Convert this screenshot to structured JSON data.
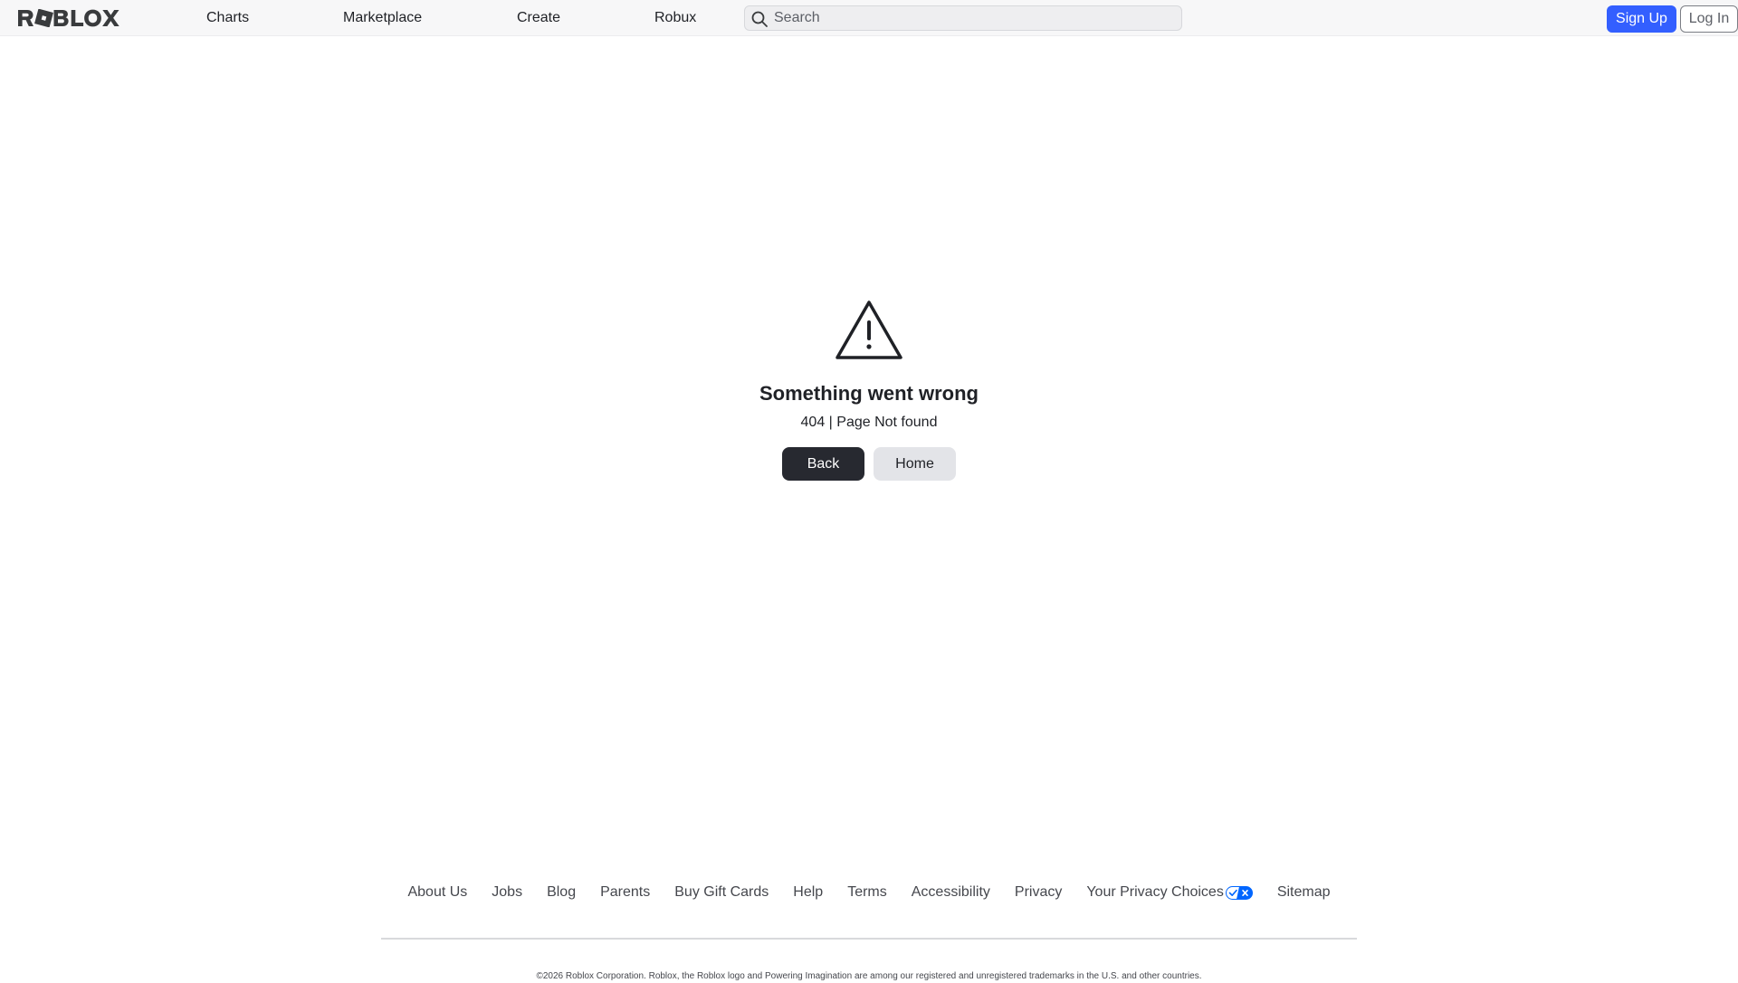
{
  "brand": {
    "logo_text": "ROBLOX",
    "accent": "#335fff"
  },
  "nav": {
    "items": [
      {
        "label": "Charts"
      },
      {
        "label": "Marketplace"
      },
      {
        "label": "Create"
      },
      {
        "label": "Robux"
      }
    ],
    "search": {
      "placeholder": "Search",
      "value": "",
      "icon": "search-icon"
    },
    "signup_label": "Sign Up",
    "login_label": "Log In"
  },
  "error": {
    "icon": "warning-triangle-icon",
    "title": "Something went wrong",
    "message": "404 | Page Not found",
    "back_label": "Back",
    "home_label": "Home"
  },
  "footer": {
    "links": [
      {
        "label": "About Us"
      },
      {
        "label": "Jobs"
      },
      {
        "label": "Blog"
      },
      {
        "label": "Parents"
      },
      {
        "label": "Buy Gift Cards"
      },
      {
        "label": "Help"
      },
      {
        "label": "Terms"
      },
      {
        "label": "Accessibility"
      },
      {
        "label": "Privacy"
      },
      {
        "label": "Your Privacy Choices",
        "icon": "privacy-choices-toggle-icon"
      },
      {
        "label": "Sitemap"
      }
    ],
    "copyright": "©2026 Roblox Corporation. Roblox, the Roblox logo and Powering Imagination are among our registered and unregistered trademarks in the U.S. and other countries."
  }
}
